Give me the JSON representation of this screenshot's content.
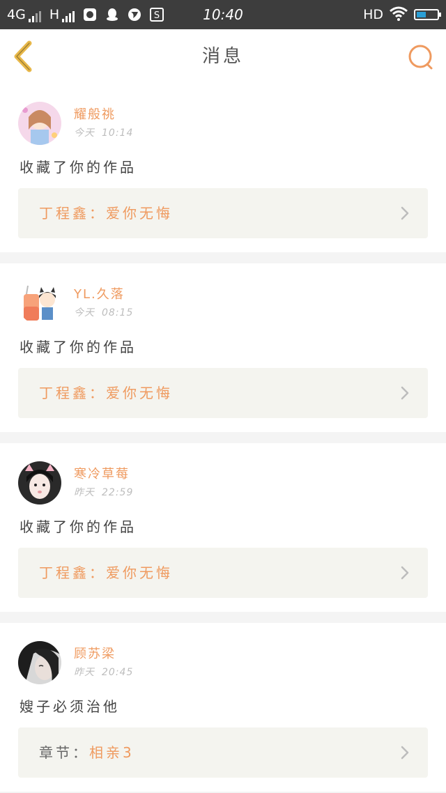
{
  "status_bar": {
    "network_1": "4G",
    "network_2": "H",
    "time": "10:40",
    "hd": "HD",
    "battery_level": 0.45,
    "icons": [
      "signal-icon",
      "signal-icon",
      "app-icon",
      "qq-icon",
      "browser-icon",
      "s-app-icon",
      "wifi-icon",
      "battery-icon"
    ]
  },
  "nav": {
    "title": "消息",
    "back_icon": "back-chevron-icon",
    "search_icon": "search-icon",
    "accent": "#ef9a5f",
    "back_color": "#e8b84a"
  },
  "messages": [
    {
      "username": "耀般祧",
      "day": "今天",
      "time": "10:14",
      "action": "收藏了你的作品",
      "ref_prefix": "丁程鑫：",
      "ref_title": "爱你无悔"
    },
    {
      "username": "YL.久落",
      "day": "今天",
      "time": "08:15",
      "action": "收藏了你的作品",
      "ref_prefix": "丁程鑫：",
      "ref_title": "爱你无悔"
    },
    {
      "username": "寒冷草莓",
      "day": "昨天",
      "time": "22:59",
      "action": "收藏了你的作品",
      "ref_prefix": "丁程鑫：",
      "ref_title": "爱你无悔"
    },
    {
      "username": "顾苏梁",
      "day": "昨天",
      "time": "20:45",
      "action": "嫂子必须治他",
      "ref_prefix": "章节：",
      "ref_title": "相亲3"
    }
  ]
}
